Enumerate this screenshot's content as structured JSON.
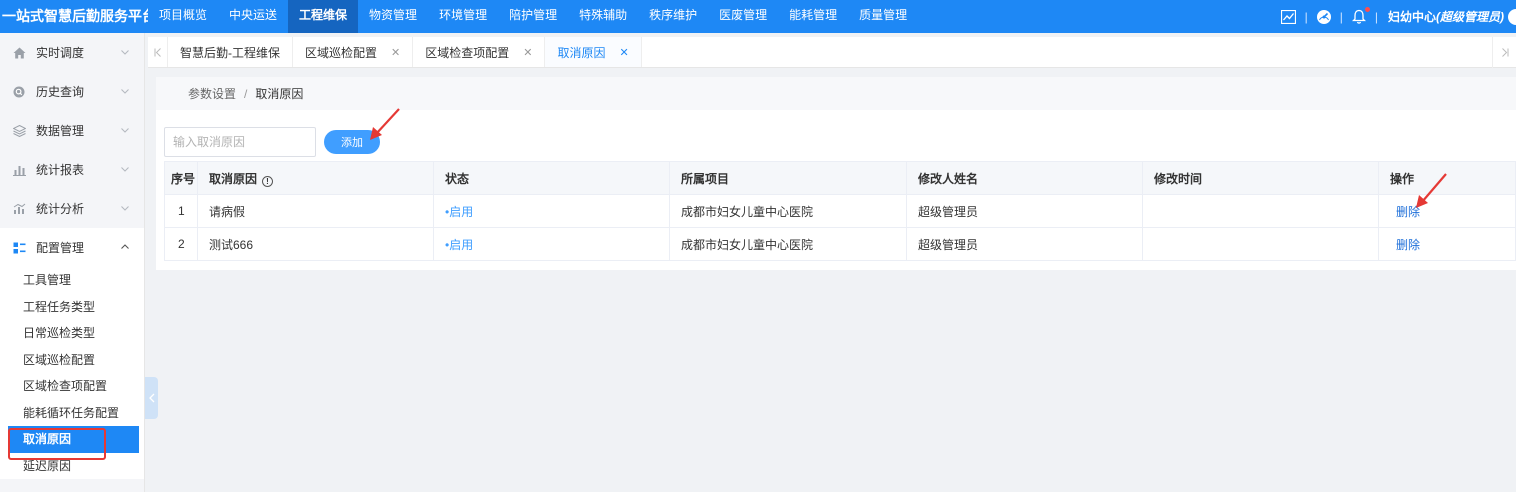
{
  "header": {
    "brand": "一站式智慧后勤服务平台",
    "nav": [
      "项目概览",
      "中央运送",
      "工程维保",
      "物资管理",
      "环境管理",
      "陪护管理",
      "特殊辅助",
      "秩序维护",
      "医废管理",
      "能耗管理",
      "质量管理"
    ],
    "active_nav_index": 2,
    "separator": "|",
    "user_label": "妇幼中心",
    "user_role": "(超级管理员)",
    "icons": [
      "chart-line-icon",
      "dashboard-gauge-icon",
      "bell-icon"
    ]
  },
  "sidebar": {
    "groups": [
      {
        "label": "实时调度",
        "icon": "home-icon"
      },
      {
        "label": "历史查询",
        "icon": "search-icon"
      },
      {
        "label": "数据管理",
        "icon": "layers-icon"
      },
      {
        "label": "统计报表",
        "icon": "bar-chart-icon"
      },
      {
        "label": "统计分析",
        "icon": "analysis-chart-icon"
      },
      {
        "label": "配置管理",
        "icon": "grid-config-icon"
      }
    ],
    "open_group_index": 5,
    "submenu": [
      "工具管理",
      "工程任务类型",
      "日常巡检类型",
      "区域巡检配置",
      "区域检查项配置",
      "能耗循环任务配置",
      "取消原因",
      "延迟原因"
    ],
    "active_sub_index": 6
  },
  "tabs": {
    "items": [
      {
        "label": "智慧后勤-工程维保",
        "closable": false
      },
      {
        "label": "区域巡检配置",
        "closable": true
      },
      {
        "label": "区域检查项配置",
        "closable": true
      },
      {
        "label": "取消原因",
        "closable": true
      }
    ],
    "active_index": 3,
    "close_glyph": "✕"
  },
  "breadcrumb": {
    "parent": "参数设置",
    "separator": "/",
    "current": "取消原因"
  },
  "toolbar": {
    "search_placeholder": "输入取消原因",
    "search_value": "",
    "add_label": "添加"
  },
  "table": {
    "columns": [
      "序号",
      "取消原因",
      "状态",
      "所属项目",
      "修改人姓名",
      "修改时间",
      "操作"
    ],
    "rows": [
      {
        "index": "1",
        "reason": "请病假",
        "status": "启用",
        "project": "成都市妇女儿童中心医院",
        "modifier": "超级管理员",
        "modified_time": "",
        "action": "删除"
      },
      {
        "index": "2",
        "reason": "测试666",
        "status": "启用",
        "project": "成都市妇女儿童中心医院",
        "modifier": "超级管理员",
        "modified_time": "",
        "action": "删除"
      }
    ],
    "status_dot": "•"
  },
  "colors": {
    "primary": "#1e88f5",
    "active_nav": "#1565c0",
    "link": "#1e6fd9",
    "annotation": "#e53935"
  }
}
